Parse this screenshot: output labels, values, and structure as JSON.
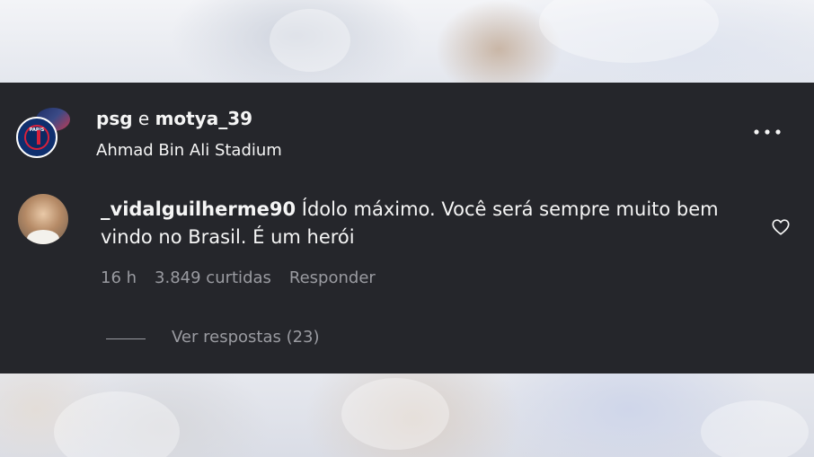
{
  "post": {
    "account_primary": "psg",
    "connector": "e",
    "account_secondary": "motya_39",
    "location": "Ahmad Bin Ali Stadium",
    "avatar_badge_text": "PARIS"
  },
  "comment": {
    "username": "_vidalguilherme90",
    "text": "Ídolo máximo. Você será sempre muito bem vindo no Brasil. É um herói",
    "time": "16 h",
    "likes": "3.849 curtidas",
    "reply_label": "Responder",
    "view_replies_label": "Ver respostas (23)"
  },
  "icons": {
    "more": "more-horizontal-icon",
    "like": "heart-outline-icon"
  },
  "colors": {
    "panel_background": "#25262b",
    "primary_text": "#f5f5f5",
    "secondary_text": "#9a9ba1"
  }
}
